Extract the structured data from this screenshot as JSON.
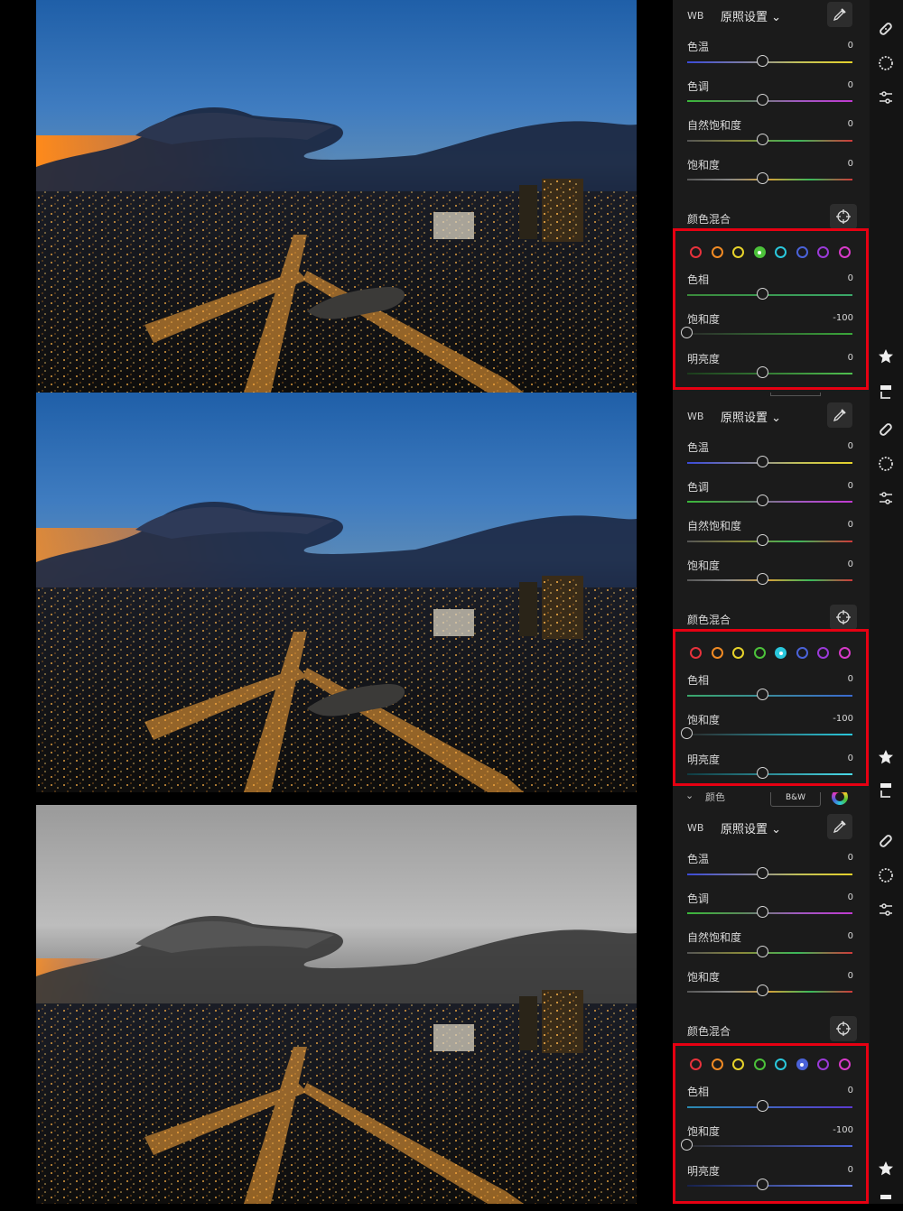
{
  "panels": [
    {
      "id": "p1",
      "wb_label": "WB",
      "wb_value": "原照设置",
      "sliders": [
        {
          "label": "色温",
          "value": "0"
        },
        {
          "label": "色调",
          "value": "0"
        },
        {
          "label": "自然饱和度",
          "value": "0"
        },
        {
          "label": "饱和度",
          "value": "0"
        }
      ],
      "color_mix_label": "颜色混合",
      "selected_color": "green",
      "mix_sliders": [
        {
          "label": "色相",
          "value": "0"
        },
        {
          "label": "饱和度",
          "value": "-100"
        },
        {
          "label": "明亮度",
          "value": "0"
        }
      ]
    },
    {
      "id": "p2",
      "wb_label": "WB",
      "wb_value": "原照设置",
      "sliders": [
        {
          "label": "色温",
          "value": "0"
        },
        {
          "label": "色调",
          "value": "0"
        },
        {
          "label": "自然饱和度",
          "value": "0"
        },
        {
          "label": "饱和度",
          "value": "0"
        }
      ],
      "color_mix_label": "颜色混合",
      "selected_color": "aqua",
      "mix_sliders": [
        {
          "label": "色相",
          "value": "0"
        },
        {
          "label": "饱和度",
          "value": "-100"
        },
        {
          "label": "明亮度",
          "value": "0"
        }
      ]
    },
    {
      "id": "p3",
      "section_title": "颜色",
      "bw_label": "B&W",
      "wb_label": "WB",
      "wb_value": "原照设置",
      "sliders": [
        {
          "label": "色温",
          "value": "0"
        },
        {
          "label": "色调",
          "value": "0"
        },
        {
          "label": "自然饱和度",
          "value": "0"
        },
        {
          "label": "饱和度",
          "value": "0"
        }
      ],
      "color_mix_label": "颜色混合",
      "selected_color": "blue",
      "mix_sliders": [
        {
          "label": "色相",
          "value": "0"
        },
        {
          "label": "饱和度",
          "value": "-100"
        },
        {
          "label": "明亮度",
          "value": "0"
        }
      ]
    }
  ],
  "color_swatches": [
    {
      "name": "red",
      "hex": "#e8323c"
    },
    {
      "name": "orange",
      "hex": "#f08a24"
    },
    {
      "name": "yellow",
      "hex": "#e6d22a"
    },
    {
      "name": "green",
      "hex": "#4cc23a"
    },
    {
      "name": "aqua",
      "hex": "#2ac8dc"
    },
    {
      "name": "blue",
      "hex": "#4a62d8"
    },
    {
      "name": "purple",
      "hex": "#9a3ad8"
    },
    {
      "name": "magenta",
      "hex": "#d83ac8"
    }
  ],
  "mix_track_colors": {
    "green": {
      "hue": [
        "#3a8a3a",
        "#3aa86a"
      ],
      "sat": [
        "#2a2a2a",
        "#3aa83a"
      ],
      "lum": [
        "#1c3a1c",
        "#4fc04f"
      ]
    },
    "aqua": {
      "hue": [
        "#3aa86a",
        "#3a6ad0"
      ],
      "sat": [
        "#2a2a2a",
        "#2ac8dc"
      ],
      "lum": [
        "#103a40",
        "#4adcea"
      ]
    },
    "blue": {
      "hue": [
        "#2a8ab0",
        "#5a3ad0"
      ],
      "sat": [
        "#2a2a2a",
        "#4a62d8"
      ],
      "lum": [
        "#16204a",
        "#6a82f0"
      ]
    }
  },
  "mix_knob_fractions": {
    "hue": 0.5,
    "sat": 0.0,
    "lum": 0.5
  },
  "wb_knob_fraction": 0.5,
  "highlight_color": "#e60012"
}
